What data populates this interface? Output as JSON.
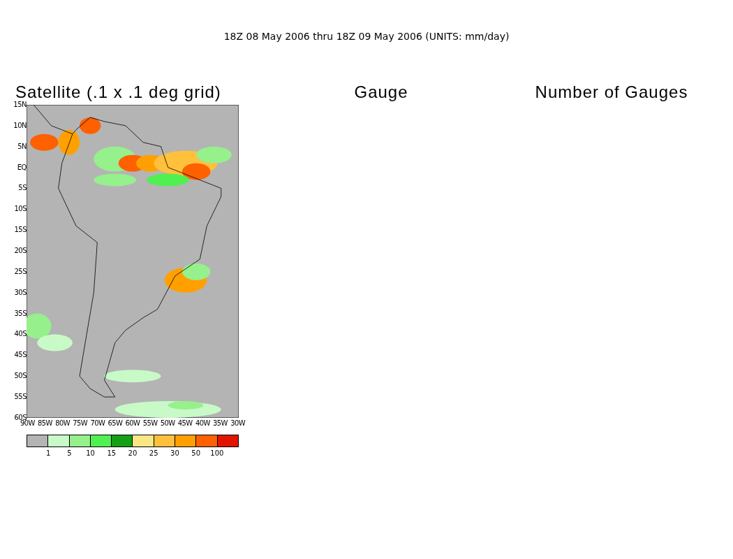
{
  "title": "18Z 08 May 2006 thru 18Z 09 May 2006 (UNITS: mm/day)",
  "panels": [
    {
      "title": "Satellite (.1 x .1 deg grid)"
    },
    {
      "title": "Gauge"
    },
    {
      "title": "Number of Gauges"
    }
  ],
  "map": {
    "y_ticks": [
      "15N",
      "10N",
      "5N",
      "EQ",
      "5S",
      "10S",
      "15S",
      "20S",
      "25S",
      "30S",
      "35S",
      "40S",
      "45S",
      "50S",
      "55S",
      "60S"
    ],
    "x_ticks": [
      "90W",
      "85W",
      "80W",
      "75W",
      "70W",
      "65W",
      "60W",
      "55W",
      "50W",
      "45W",
      "40W",
      "35W",
      "30W"
    ]
  },
  "legend": {
    "swatches": [
      {
        "color": "#b4b4b4"
      },
      {
        "color": "#c8fac8"
      },
      {
        "color": "#96f08c"
      },
      {
        "color": "#50f050"
      },
      {
        "color": "#14a014"
      },
      {
        "color": "#fae682"
      },
      {
        "color": "#ffc03c"
      },
      {
        "color": "#ffa000"
      },
      {
        "color": "#ff6000"
      },
      {
        "color": "#e11400"
      }
    ],
    "labels": [
      "1",
      "5",
      "10",
      "15",
      "20",
      "25",
      "30",
      "50",
      "100"
    ]
  }
}
